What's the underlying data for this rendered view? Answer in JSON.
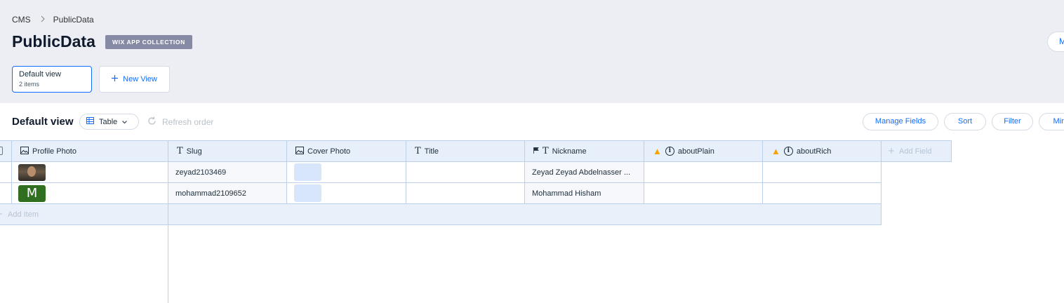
{
  "breadcrumb": {
    "root": "CMS",
    "current": "PublicData"
  },
  "page": {
    "title": "PublicData",
    "badge": "WIX APP COLLECTION",
    "top_right_button": "M"
  },
  "views": [
    {
      "name": "Default view",
      "count": "2 items"
    }
  ],
  "new_view_label": "New View",
  "toolbar": {
    "title": "Default view",
    "layout_select": "Table",
    "refresh_label": "Refresh order",
    "manage_fields": "Manage Fields",
    "sort": "Sort",
    "filter": "Filter",
    "mirror": "Mirr"
  },
  "table": {
    "columns": [
      {
        "label": "Profile Photo",
        "icon": "image-icon"
      },
      {
        "label": "Slug",
        "icon": "text-icon"
      },
      {
        "label": "Cover Photo",
        "icon": "image-icon"
      },
      {
        "label": "Title",
        "icon": "text-icon"
      },
      {
        "label": "Nickname",
        "icon": "text-icon"
      },
      {
        "label": "aboutPlain",
        "icon": "warning-icon"
      },
      {
        "label": "aboutRich",
        "icon": "warning-icon"
      }
    ],
    "add_field": "Add Field",
    "rows": [
      {
        "profile_photo": "portrait",
        "slug": "zeyad2103469",
        "cover_photo": "placeholder",
        "title": "",
        "nickname": "Zeyad Zeyad Abdelnasser ...",
        "aboutPlain": "",
        "aboutRich": ""
      },
      {
        "profile_photo": "M",
        "slug": "mohammad2109652",
        "cover_photo": "placeholder",
        "title": "",
        "nickname": "Mohammad Hisham",
        "aboutPlain": "",
        "aboutRich": ""
      }
    ],
    "add_item": "Add Item"
  },
  "colors": {
    "accent": "#116dff",
    "header_bg": "#eceef3",
    "grid_header": "#e7effb",
    "badge": "#868aa5"
  }
}
